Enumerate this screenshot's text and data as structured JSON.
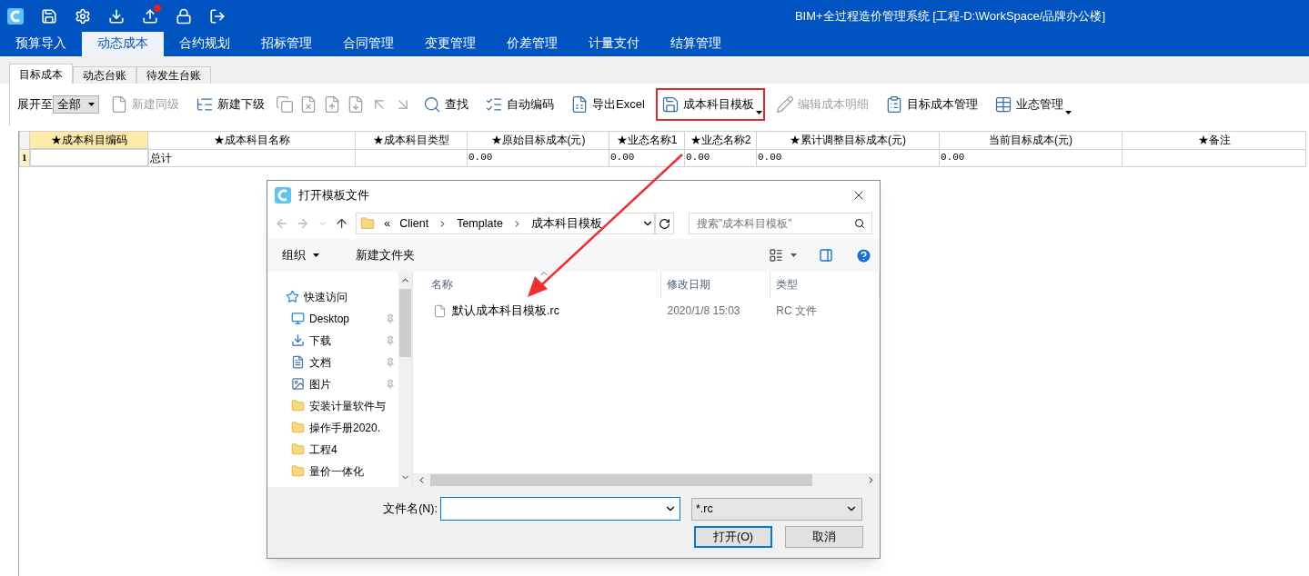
{
  "window": {
    "title": "BIM+全过程造价管理系统 [工程-D:\\WorkSpace/品牌办公楼]"
  },
  "main_tabs": [
    {
      "label": "预算导入",
      "selected": false
    },
    {
      "label": "动态成本",
      "selected": true
    },
    {
      "label": "合约规划",
      "selected": false
    },
    {
      "label": "招标管理",
      "selected": false
    },
    {
      "label": "合同管理",
      "selected": false
    },
    {
      "label": "变更管理",
      "selected": false
    },
    {
      "label": "价差管理",
      "selected": false
    },
    {
      "label": "计量支付",
      "selected": false
    },
    {
      "label": "结算管理",
      "selected": false
    }
  ],
  "sub_tabs": [
    {
      "label": "目标成本",
      "selected": true
    },
    {
      "label": "动态台账",
      "selected": false
    },
    {
      "label": "待发生台账",
      "selected": false
    }
  ],
  "toolbar": [
    {
      "kind": "dropdown",
      "label": "展开至",
      "value": "全部"
    },
    {
      "kind": "button",
      "label": "新建同级",
      "disabled": true,
      "highlighted": false,
      "has_menu": false
    },
    {
      "kind": "button",
      "label": "新建下级",
      "disabled": false,
      "highlighted": false,
      "has_menu": false
    },
    {
      "kind": "icon",
      "disabled": true
    },
    {
      "kind": "icon",
      "disabled": true
    },
    {
      "kind": "icon",
      "disabled": true
    },
    {
      "kind": "icon",
      "disabled": true
    },
    {
      "kind": "icon",
      "disabled": true
    },
    {
      "kind": "icon",
      "disabled": true
    },
    {
      "kind": "button",
      "label": "查找",
      "disabled": false,
      "highlighted": false,
      "has_menu": false
    },
    {
      "kind": "button",
      "label": "自动编码",
      "disabled": false,
      "highlighted": false,
      "has_menu": false
    },
    {
      "kind": "button",
      "label": "导出Excel",
      "disabled": false,
      "highlighted": false,
      "has_menu": false
    },
    {
      "kind": "button",
      "label": "成本科目模板",
      "disabled": false,
      "highlighted": true,
      "has_menu": true
    },
    {
      "kind": "button",
      "label": "编辑成本明细",
      "disabled": true,
      "highlighted": false,
      "has_menu": false
    },
    {
      "kind": "button",
      "label": "目标成本管理",
      "disabled": false,
      "highlighted": false,
      "has_menu": false
    },
    {
      "kind": "button",
      "label": "业态管理",
      "disabled": false,
      "highlighted": false,
      "has_menu": true
    }
  ],
  "table": {
    "columns": [
      {
        "label": "★成本科目编码",
        "selected": true
      },
      {
        "label": "★成本科目名称",
        "selected": false
      },
      {
        "label": "★成本科目类型",
        "selected": false
      },
      {
        "label": "★原始目标成本(元)",
        "selected": false
      },
      {
        "label": "★业态名称1",
        "selected": false
      },
      {
        "label": "★业态名称2",
        "selected": false
      },
      {
        "label": "★累计调整目标成本(元)",
        "selected": false
      },
      {
        "label": "当前目标成本(元)",
        "selected": false
      },
      {
        "label": "★备注",
        "selected": false
      }
    ],
    "rows": [
      {
        "number": "1",
        "cells": [
          "",
          "总计",
          "",
          "0.00",
          "0.00",
          "0.00",
          "0.00",
          "0.00",
          ""
        ]
      }
    ]
  },
  "dialog": {
    "title": "打开模板文件",
    "path_overflow": "«",
    "path": [
      "Client",
      "Template",
      "成本科目模板"
    ],
    "search_placeholder": "搜索\"成本科目模板\"",
    "commands": [
      {
        "label": "组织",
        "has_menu": true
      },
      {
        "label": "新建文件夹",
        "has_menu": false
      }
    ],
    "nav": [
      {
        "kind": "star",
        "label": "快速访问",
        "pinned": false
      },
      {
        "kind": "desktop",
        "label": "Desktop",
        "pinned": true
      },
      {
        "kind": "download",
        "label": "下载",
        "pinned": true
      },
      {
        "kind": "document",
        "label": "文档",
        "pinned": true
      },
      {
        "kind": "picture",
        "label": "图片",
        "pinned": true
      },
      {
        "kind": "folder",
        "label": "安装计量软件与",
        "pinned": false
      },
      {
        "kind": "folder",
        "label": "操作手册2020.",
        "pinned": false
      },
      {
        "kind": "folder",
        "label": "工程4",
        "pinned": false
      },
      {
        "kind": "folder",
        "label": "量价一体化",
        "pinned": false
      }
    ],
    "columns": [
      "名称",
      "修改日期",
      "类型"
    ],
    "files": [
      {
        "name": "默认成本科目模板.rc",
        "modified": "2020/1/8 15:03",
        "type": "RC 文件"
      }
    ],
    "filename_label": "文件名(N):",
    "filetype": "*.rc",
    "buttons": [
      {
        "label": "打开(O)",
        "primary": true
      },
      {
        "label": "取消",
        "primary": false
      }
    ]
  }
}
